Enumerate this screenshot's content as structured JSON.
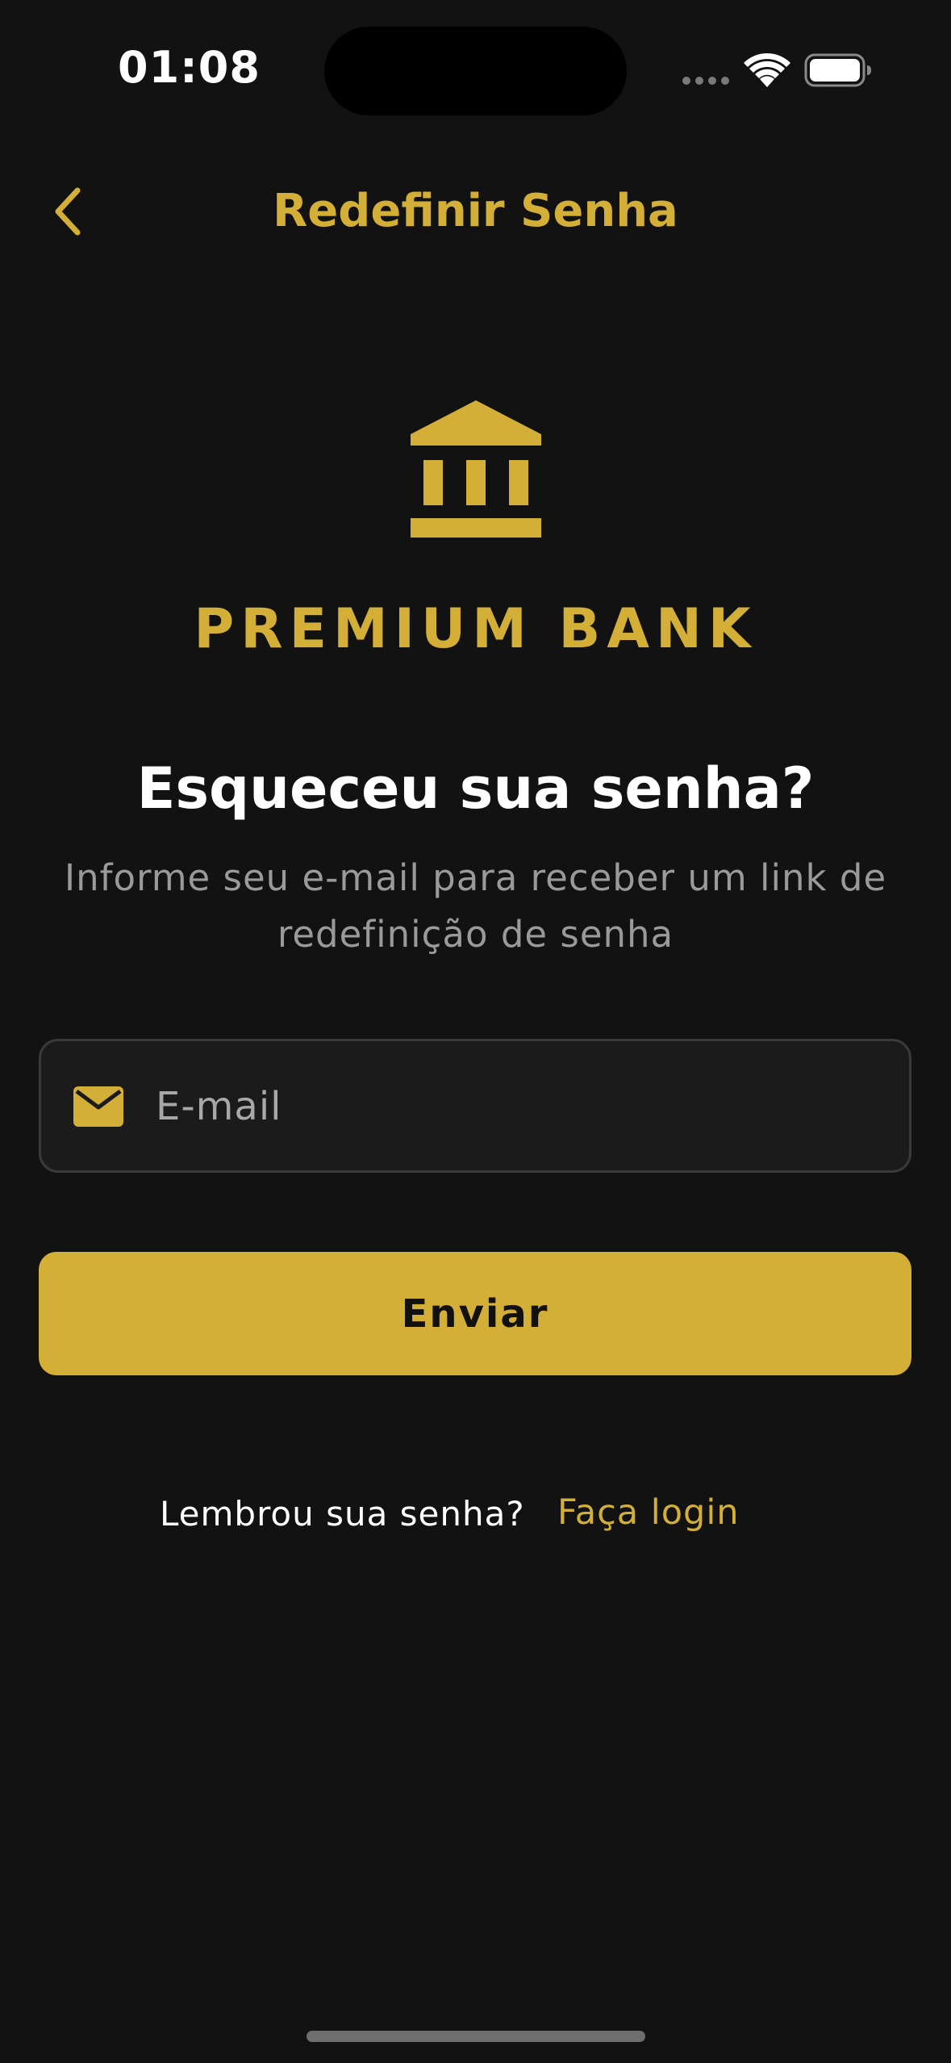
{
  "status_bar": {
    "time": "01:08"
  },
  "header": {
    "title": "Redefinir Senha",
    "back_icon": "chevron-left-icon"
  },
  "logo": {
    "icon": "bank-building-icon",
    "brand_name": "PREMIUM BANK"
  },
  "main": {
    "headline": "Esqueceu sua senha?",
    "subtitle": "Informe seu e-mail para receber um link de redefinição de senha"
  },
  "form": {
    "email": {
      "icon": "mail-icon",
      "placeholder": "E-mail",
      "value": ""
    },
    "submit_label": "Enviar"
  },
  "footer": {
    "prompt": "Lembrou sua senha?",
    "link_label": "Faça login"
  },
  "colors": {
    "background": "#121212",
    "accent": "#d4af37",
    "field_background": "#1b1b1b",
    "field_border": "#3a3a3a",
    "muted_text": "#9a9a9a"
  }
}
